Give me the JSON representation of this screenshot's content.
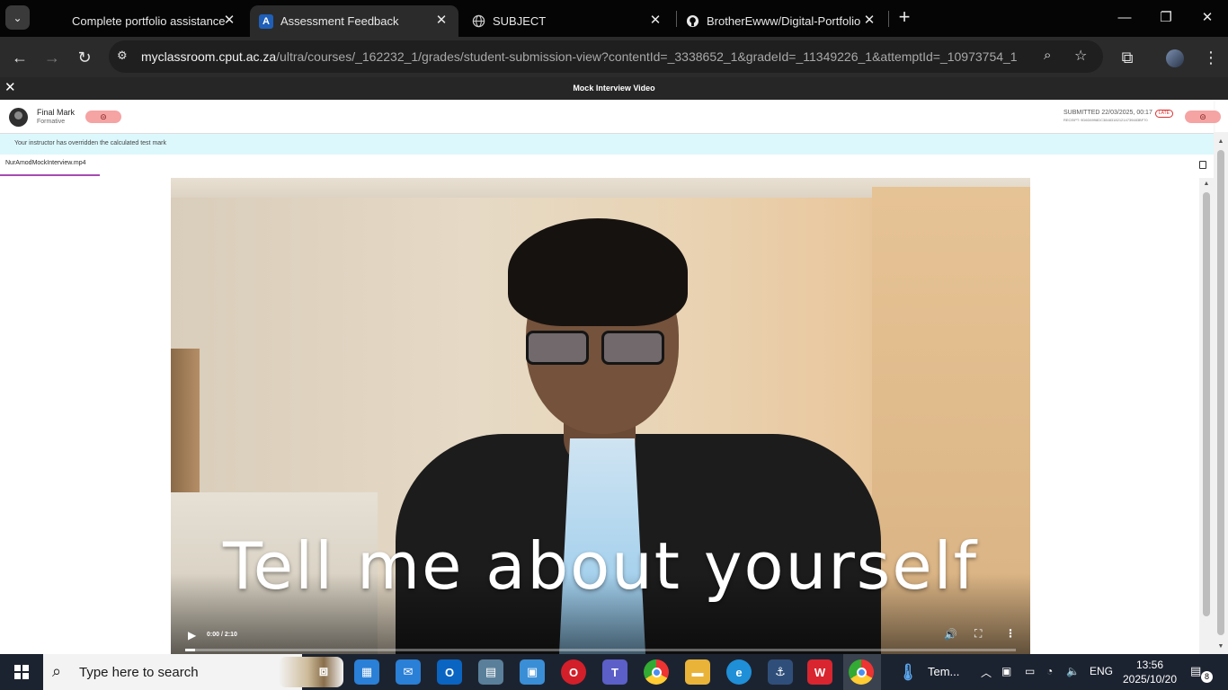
{
  "browser": {
    "tabs": [
      {
        "title": "Complete portfolio assistance",
        "active": false
      },
      {
        "title": "Assessment Feedback",
        "active": true
      },
      {
        "title": "SUBJECT",
        "active": false
      },
      {
        "title": "BrotherEwww/Digital-Portfolio",
        "active": false
      }
    ],
    "url_host": "myclassroom.cput.ac.za",
    "url_path": "/ultra/courses/_162232_1/grades/student-submission-view?contentId=_3338652_1&gradeId=_11349226_1&attemptId=_10973754_1"
  },
  "viewer": {
    "title": "Mock Interview Video"
  },
  "mark": {
    "title": "Final Mark",
    "subtitle": "Formative",
    "pill_symbol": "⊝",
    "submitted": "SUBMITTED 22/03/2025, 00:17",
    "late": "LATE",
    "receipt": "RECEIPT: 9D6D6998DC384831821214739483BF70"
  },
  "notice": "Your instructor has overridden the calculated test mark",
  "file": {
    "name": "NurAmodMockInterview.mp4"
  },
  "video": {
    "subtitle": "Tell me about yourself",
    "time": "0:00 / 2:10",
    "progress": 0.0
  },
  "taskbar": {
    "search_placeholder": "Type here to search",
    "weather": "Tem...",
    "language": "ENG",
    "time": "13:56",
    "date": "2025/10/20",
    "notifications": "8"
  }
}
